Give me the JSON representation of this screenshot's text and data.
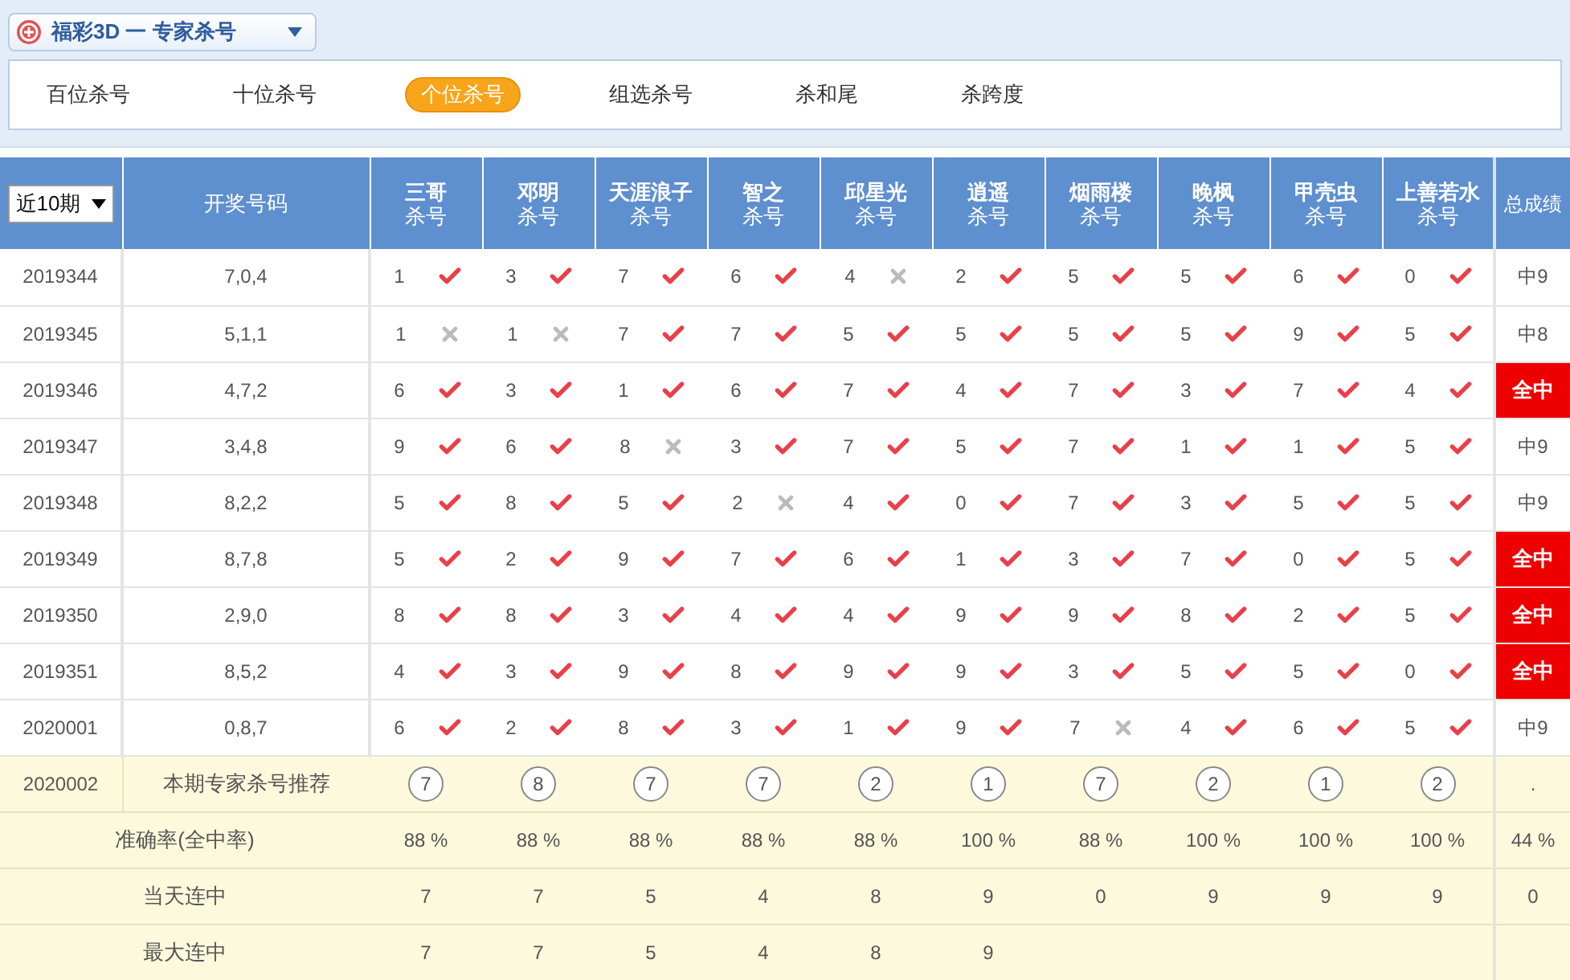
{
  "title": "福彩3D 一 专家杀号",
  "tabs": [
    {
      "label": "百位杀号",
      "selected": false
    },
    {
      "label": "十位杀号",
      "selected": false
    },
    {
      "label": "个位杀号",
      "selected": true
    },
    {
      "label": "组选杀号",
      "selected": false
    },
    {
      "label": "杀和尾",
      "selected": false
    },
    {
      "label": "杀跨度",
      "selected": false
    }
  ],
  "period_select": {
    "value": "近10期"
  },
  "columns": {
    "draw": "开奖号码",
    "total": "总成绩"
  },
  "experts": [
    {
      "name": "三哥",
      "sub": "杀号"
    },
    {
      "name": "邓明",
      "sub": "杀号"
    },
    {
      "name": "天涯浪子",
      "sub": "杀号"
    },
    {
      "name": "智之",
      "sub": "杀号"
    },
    {
      "name": "邱星光",
      "sub": "杀号"
    },
    {
      "name": "逍遥",
      "sub": "杀号"
    },
    {
      "name": "烟雨楼",
      "sub": "杀号"
    },
    {
      "name": "晚枫",
      "sub": "杀号"
    },
    {
      "name": "甲壳虫",
      "sub": "杀号"
    },
    {
      "name": "上善若水",
      "sub": "杀号"
    }
  ],
  "rows": [
    {
      "period": "2019344",
      "draw": "7,0,4",
      "picks": [
        {
          "number": "1",
          "hit": true
        },
        {
          "number": "3",
          "hit": true
        },
        {
          "number": "7",
          "hit": true
        },
        {
          "number": "6",
          "hit": true
        },
        {
          "number": "4",
          "hit": false
        },
        {
          "number": "2",
          "hit": true
        },
        {
          "number": "5",
          "hit": true
        },
        {
          "number": "5",
          "hit": true
        },
        {
          "number": "6",
          "hit": true
        },
        {
          "number": "0",
          "hit": true
        }
      ],
      "total": "中9",
      "full": false
    },
    {
      "period": "2019345",
      "draw": "5,1,1",
      "picks": [
        {
          "number": "1",
          "hit": false
        },
        {
          "number": "1",
          "hit": false
        },
        {
          "number": "7",
          "hit": true
        },
        {
          "number": "7",
          "hit": true
        },
        {
          "number": "5",
          "hit": true
        },
        {
          "number": "5",
          "hit": true
        },
        {
          "number": "5",
          "hit": true
        },
        {
          "number": "5",
          "hit": true
        },
        {
          "number": "9",
          "hit": true
        },
        {
          "number": "5",
          "hit": true
        }
      ],
      "total": "中8",
      "full": false
    },
    {
      "period": "2019346",
      "draw": "4,7,2",
      "picks": [
        {
          "number": "6",
          "hit": true
        },
        {
          "number": "3",
          "hit": true
        },
        {
          "number": "1",
          "hit": true
        },
        {
          "number": "6",
          "hit": true
        },
        {
          "number": "7",
          "hit": true
        },
        {
          "number": "4",
          "hit": true
        },
        {
          "number": "7",
          "hit": true
        },
        {
          "number": "3",
          "hit": true
        },
        {
          "number": "7",
          "hit": true
        },
        {
          "number": "4",
          "hit": true
        }
      ],
      "total": "全中",
      "full": true
    },
    {
      "period": "2019347",
      "draw": "3,4,8",
      "picks": [
        {
          "number": "9",
          "hit": true
        },
        {
          "number": "6",
          "hit": true
        },
        {
          "number": "8",
          "hit": false
        },
        {
          "number": "3",
          "hit": true
        },
        {
          "number": "7",
          "hit": true
        },
        {
          "number": "5",
          "hit": true
        },
        {
          "number": "7",
          "hit": true
        },
        {
          "number": "1",
          "hit": true
        },
        {
          "number": "1",
          "hit": true
        },
        {
          "number": "5",
          "hit": true
        }
      ],
      "total": "中9",
      "full": false
    },
    {
      "period": "2019348",
      "draw": "8,2,2",
      "picks": [
        {
          "number": "5",
          "hit": true
        },
        {
          "number": "8",
          "hit": true
        },
        {
          "number": "5",
          "hit": true
        },
        {
          "number": "2",
          "hit": false
        },
        {
          "number": "4",
          "hit": true
        },
        {
          "number": "0",
          "hit": true
        },
        {
          "number": "7",
          "hit": true
        },
        {
          "number": "3",
          "hit": true
        },
        {
          "number": "5",
          "hit": true
        },
        {
          "number": "5",
          "hit": true
        }
      ],
      "total": "中9",
      "full": false
    },
    {
      "period": "2019349",
      "draw": "8,7,8",
      "picks": [
        {
          "number": "5",
          "hit": true
        },
        {
          "number": "2",
          "hit": true
        },
        {
          "number": "9",
          "hit": true
        },
        {
          "number": "7",
          "hit": true
        },
        {
          "number": "6",
          "hit": true
        },
        {
          "number": "1",
          "hit": true
        },
        {
          "number": "3",
          "hit": true
        },
        {
          "number": "7",
          "hit": true
        },
        {
          "number": "0",
          "hit": true
        },
        {
          "number": "5",
          "hit": true
        }
      ],
      "total": "全中",
      "full": true
    },
    {
      "period": "2019350",
      "draw": "2,9,0",
      "picks": [
        {
          "number": "8",
          "hit": true
        },
        {
          "number": "8",
          "hit": true
        },
        {
          "number": "3",
          "hit": true
        },
        {
          "number": "4",
          "hit": true
        },
        {
          "number": "4",
          "hit": true
        },
        {
          "number": "9",
          "hit": true
        },
        {
          "number": "9",
          "hit": true
        },
        {
          "number": "8",
          "hit": true
        },
        {
          "number": "2",
          "hit": true
        },
        {
          "number": "5",
          "hit": true
        }
      ],
      "total": "全中",
      "full": true
    },
    {
      "period": "2019351",
      "draw": "8,5,2",
      "picks": [
        {
          "number": "4",
          "hit": true
        },
        {
          "number": "3",
          "hit": true
        },
        {
          "number": "9",
          "hit": true
        },
        {
          "number": "8",
          "hit": true
        },
        {
          "number": "9",
          "hit": true
        },
        {
          "number": "9",
          "hit": true
        },
        {
          "number": "3",
          "hit": true
        },
        {
          "number": "5",
          "hit": true
        },
        {
          "number": "5",
          "hit": true
        },
        {
          "number": "0",
          "hit": true
        }
      ],
      "total": "全中",
      "full": true
    },
    {
      "period": "2020001",
      "draw": "0,8,7",
      "picks": [
        {
          "number": "6",
          "hit": true
        },
        {
          "number": "2",
          "hit": true
        },
        {
          "number": "8",
          "hit": true
        },
        {
          "number": "3",
          "hit": true
        },
        {
          "number": "1",
          "hit": true
        },
        {
          "number": "9",
          "hit": true
        },
        {
          "number": "7",
          "hit": false
        },
        {
          "number": "4",
          "hit": true
        },
        {
          "number": "6",
          "hit": true
        },
        {
          "number": "5",
          "hit": true
        }
      ],
      "total": "中9",
      "full": false
    }
  ],
  "recommendation": {
    "period": "2020002",
    "label": "本期专家杀号推荐",
    "numbers": [
      "7",
      "8",
      "7",
      "7",
      "2",
      "1",
      "7",
      "2",
      "1",
      "2"
    ],
    "total": "."
  },
  "stats": [
    {
      "label": "准确率(全中率)",
      "values": [
        "88 %",
        "88 %",
        "88 %",
        "88 %",
        "88 %",
        "100 %",
        "88 %",
        "100 %",
        "100 %",
        "100 %"
      ],
      "total": "44 %"
    },
    {
      "label": "当天连中",
      "values": [
        "7",
        "7",
        "5",
        "4",
        "8",
        "9",
        "0",
        "9",
        "9",
        "9"
      ],
      "total": "0"
    },
    {
      "label": "最大连中",
      "values": [
        "7",
        "7",
        "5",
        "4",
        "8",
        "9"
      ]
    }
  ]
}
